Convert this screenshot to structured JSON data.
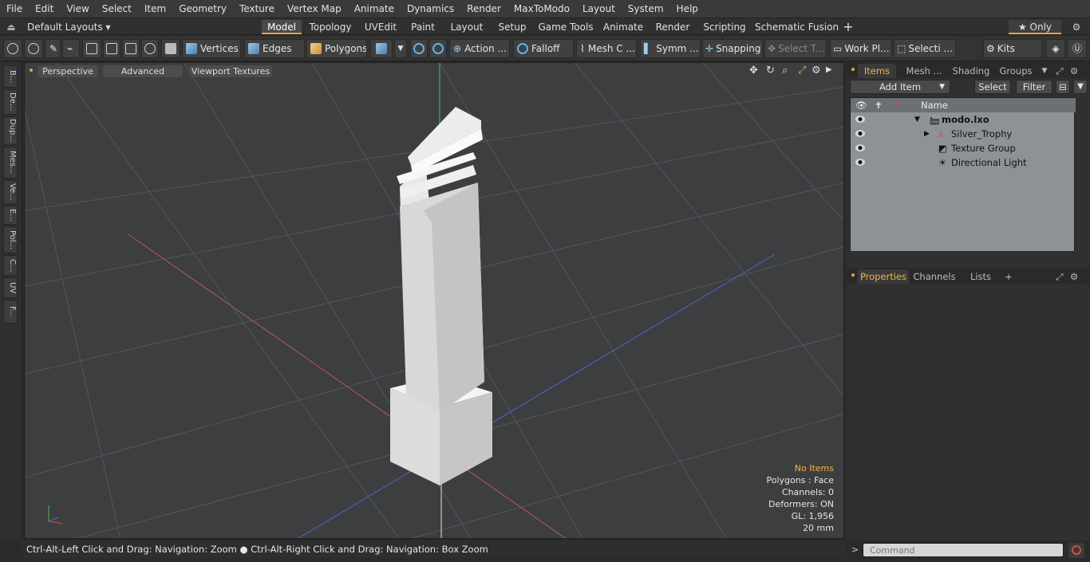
{
  "menu": [
    "File",
    "Edit",
    "View",
    "Select",
    "Item",
    "Geometry",
    "Texture",
    "Vertex Map",
    "Animate",
    "Dynamics",
    "Render",
    "MaxToModo",
    "Layout",
    "System",
    "Help"
  ],
  "layout": {
    "preset": "Default Layouts ▾",
    "tabs": [
      "Model",
      "Topology",
      "UVEdit",
      "Paint",
      "Layout",
      "Setup",
      "Game Tools",
      "Animate",
      "Render",
      "Scripting",
      "Schematic Fusion"
    ],
    "active": "Model",
    "add": "+",
    "only": "★ Only"
  },
  "toolbar": {
    "vertices": "Vertices",
    "edges": "Edges",
    "polygons": "Polygons",
    "action": "Action ...",
    "falloff": "Falloff",
    "mesh": "Mesh C ...",
    "symm": "Symm ...",
    "snapping": "Snapping",
    "select_t": "Select T...",
    "work_pl": "Work Pl...",
    "selecti": "Selecti ...",
    "kits": "Kits"
  },
  "left_tabs": [
    "B...",
    "De...",
    "Dup...",
    "Mes...",
    "Ve...",
    "E...",
    "Pol...",
    "C...",
    "UV",
    "F..."
  ],
  "viewport": {
    "perspective": "Perspective",
    "advanced": "Advanced",
    "textures": "Viewport Textures",
    "info": {
      "items": "No Items",
      "polygons": "Polygons : Face",
      "channels": "Channels: 0",
      "deformers": "Deformers: ON",
      "gl": "GL: 1,956",
      "scale": "20 mm"
    }
  },
  "status": "Ctrl-Alt-Left Click and Drag: Navigation: Zoom ● Ctrl-Alt-Right Click and Drag: Navigation: Box Zoom",
  "panel": {
    "tabs": [
      "Items",
      "Mesh ...",
      "Shading",
      "Groups"
    ],
    "add_item": "Add Item",
    "select": "Select",
    "filter": "Filter",
    "name_col": "Name",
    "items": [
      {
        "label": "modo.lxo"
      },
      {
        "label": "Silver_Trophy"
      },
      {
        "label": "Texture Group"
      },
      {
        "label": "Directional Light"
      }
    ],
    "props_tabs": [
      "Properties",
      "Channels",
      "Lists"
    ],
    "plus": "+"
  },
  "command": {
    "placeholder": "Command"
  }
}
